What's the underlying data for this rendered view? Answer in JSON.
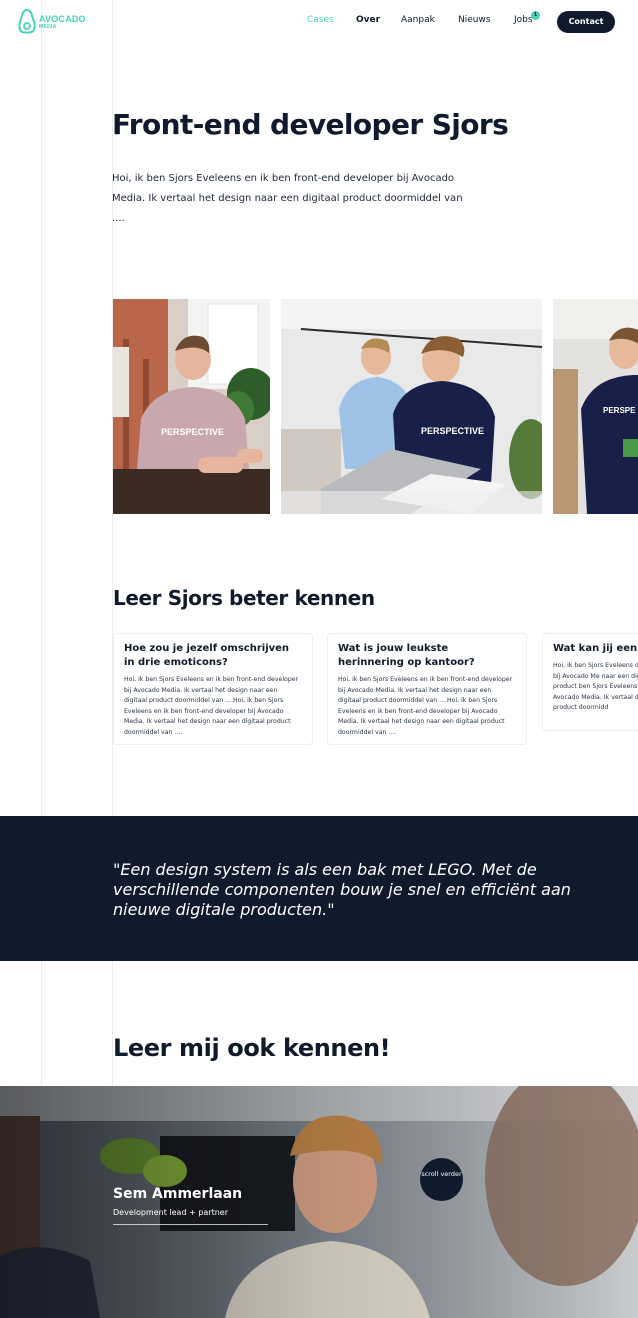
{
  "brand": {
    "name": "AVOCADO",
    "sub": "MEDIA",
    "accent": "#46d3b6",
    "dark": "#0f1b2d"
  },
  "nav": {
    "cases": "Cases",
    "over": "Over",
    "aanpak": "Aanpak",
    "nieuws": "Nieuws",
    "jobs": "Jobs",
    "jobs_badge": "1",
    "contact": "Contact"
  },
  "hero": {
    "title": "Front-end developer Sjors",
    "intro": "Hoi, ik ben Sjors Eveleens en ik ben front-end developer bij Avocado Media. Ik vertaal het design naar een digitaal product doormiddel van ...."
  },
  "know_section": {
    "title": "Leer Sjors beter kennen",
    "cards": [
      {
        "question": "Hoe zou je jezelf omschrijven in drie emoticons?",
        "answer": "Hoi, ik ben Sjors Eveleens en ik ben front-end developer bij Avocado Media. Ik vertaal het design naar een digitaal product doormiddel van ....Hoi, ik ben Sjors Eveleens en ik ben front-end developer bij Avocado Media. Ik vertaal het design naar een digitaal product doormiddel van ...."
      },
      {
        "question": "Wat is jouw leukste herinnering op kantoor?",
        "answer": "Hoi, ik ben Sjors Eveleens en ik ben front-end developer bij Avocado Media. Ik vertaal het design naar een digitaal product doormiddel van ....Hoi, ik ben Sjors Eveleens en ik ben front-end developer bij Avocado Media. Ik vertaal het design naar een digitaal product doormiddel van ...."
      },
      {
        "question": "Wat kan jij een da",
        "answer": "Hoi, ik ben Sjors Eveleens developer bij Avocado Me naar een digitaal product ben Sjors Eveleens en ik b Avocado Media. Ik vertaal digitaal product doormidd"
      }
    ]
  },
  "quote": {
    "text": "\"Een design system is als een bak met LEGO. Met de verschillende componenten bouw je snel en efficiënt aan nieuwe digitale producten.\""
  },
  "more": {
    "title": "Leer mij ook kennen!",
    "person_name": "Sem Ammerlaan",
    "person_role": "Development lead + partner",
    "scroll_label": "scroll verder"
  }
}
